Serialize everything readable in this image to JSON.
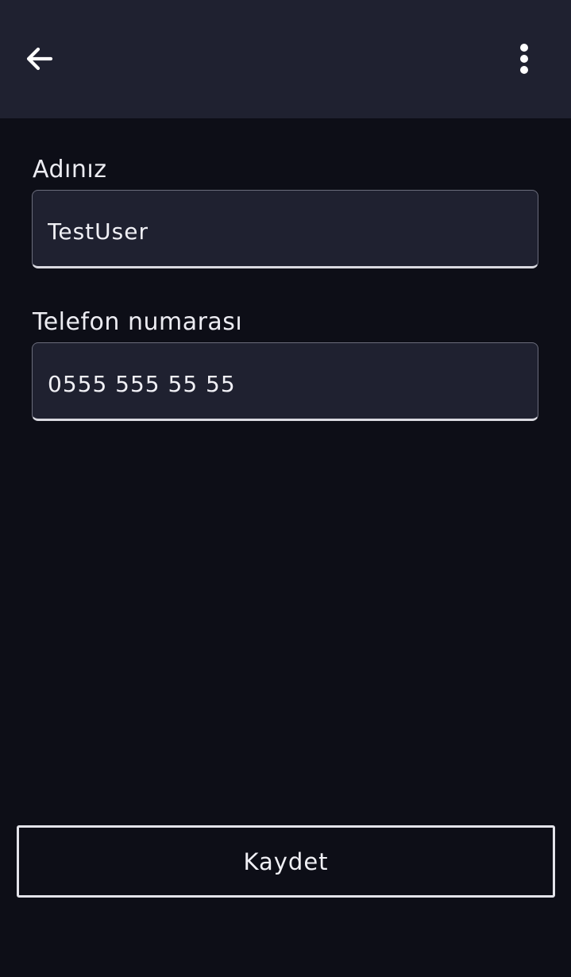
{
  "app_bar": {
    "back_icon": "arrow-left-icon",
    "menu_icon": "more-vertical-icon"
  },
  "form": {
    "name": {
      "label": "Adınız",
      "value": "TestUser"
    },
    "phone": {
      "label": "Telefon numarası",
      "value": "0555 555 55 55"
    }
  },
  "actions": {
    "save_label": "Kaydet"
  },
  "colors": {
    "background": "#0d0e17",
    "surface": "#1f2130",
    "text": "#f0f0f5",
    "border": "#e3e3ea"
  }
}
